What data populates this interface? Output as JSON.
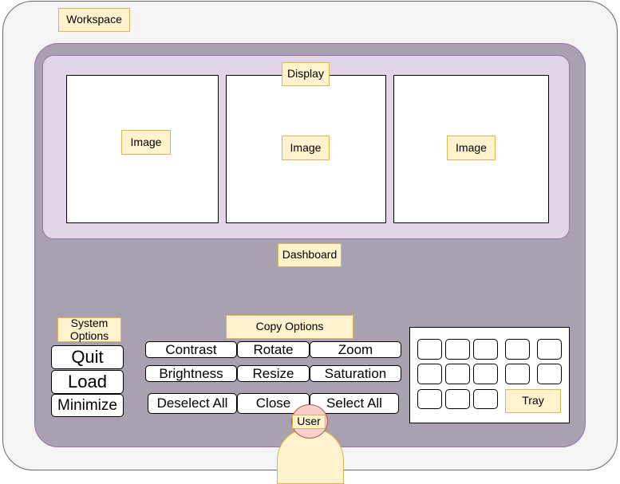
{
  "labels": {
    "workspace": "Workspace",
    "display": "Display",
    "dashboard": "Dashboard",
    "system_options": "System Options",
    "copy_options": "Copy Options",
    "tray": "Tray",
    "user": "User"
  },
  "images": [
    "Image",
    "Image",
    "Image"
  ],
  "system_buttons": {
    "quit": "Quit",
    "load": "Load",
    "minimize": "Minimize"
  },
  "copy_buttons": {
    "contrast": "Contrast",
    "rotate": "Rotate",
    "zoom": "Zoom",
    "brightness": "Brightness",
    "resize": "Resize",
    "saturation": "Saturation",
    "deselect_all": "Deselect All",
    "close": "Close",
    "select_all": "Select All"
  },
  "colors": {
    "label_fill": "#fff2cc",
    "label_border": "#d6b656",
    "dashboard_fill": "#a9a0b0",
    "display_fill": "#e1d5e7",
    "purple_border": "#9673a6",
    "user_head_fill": "#f8cecc",
    "user_head_border": "#b85450",
    "workspace_fill": "#f4f4f4"
  }
}
